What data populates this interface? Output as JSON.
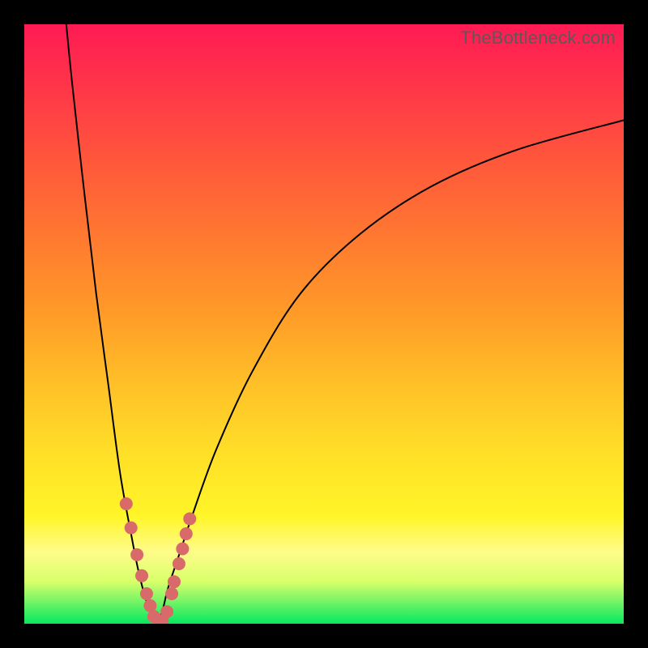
{
  "watermark": "TheBottleneck.com",
  "colors": {
    "frame": "#000000",
    "dot": "#d86a6a",
    "curve": "#000000"
  },
  "chart_data": {
    "type": "line",
    "title": "",
    "xlabel": "",
    "ylabel": "",
    "xlim": [
      0,
      100
    ],
    "ylim": [
      0,
      100
    ],
    "grid": false,
    "legend": false,
    "note": "Two-branch bottleneck curve; y is % bottleneck, x is component relative-performance index; minimum at x≈22 where branches meet at y≈0. Values estimated from pixel positions.",
    "series": [
      {
        "name": "left-branch",
        "x": [
          7,
          8,
          10,
          12,
          14,
          16,
          18,
          19,
          20,
          21,
          22
        ],
        "y": [
          100,
          90,
          72,
          55,
          40,
          25,
          14,
          9,
          5,
          2,
          0
        ]
      },
      {
        "name": "right-branch",
        "x": [
          22,
          23,
          24,
          26,
          28,
          32,
          38,
          46,
          56,
          68,
          82,
          100
        ],
        "y": [
          0,
          2,
          6,
          12,
          18,
          29,
          42,
          55,
          65,
          73,
          79,
          84
        ]
      }
    ],
    "points": {
      "name": "highlighted-dots",
      "note": "Salmon markers clustered in the lower-left V region; coordinates approximate.",
      "x": [
        17.0,
        17.8,
        18.8,
        19.6,
        20.4,
        21.0,
        21.6,
        22.4,
        23.0,
        23.8,
        24.6,
        25.0,
        25.8,
        26.4,
        27.0,
        27.6
      ],
      "y": [
        20.0,
        16.0,
        11.5,
        8.0,
        5.0,
        3.0,
        1.2,
        0.5,
        0.5,
        2.0,
        5.0,
        7.0,
        10.0,
        12.5,
        15.0,
        17.5
      ]
    }
  }
}
